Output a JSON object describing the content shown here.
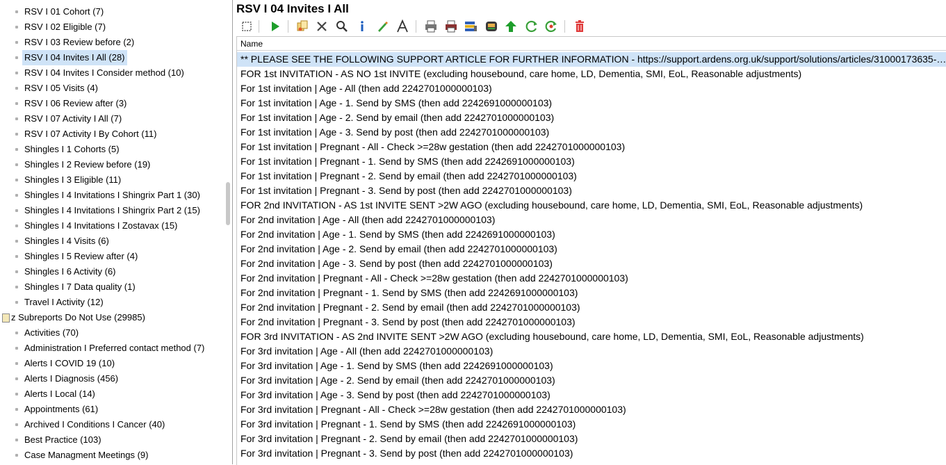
{
  "tree": {
    "items": [
      {
        "label": "RSV I 01 Cohort (7)",
        "type": "child"
      },
      {
        "label": "RSV I 02 Eligible (7)",
        "type": "child"
      },
      {
        "label": "RSV I 03 Review before (2)",
        "type": "child"
      },
      {
        "label": "RSV I 04 Invites I All (28)",
        "type": "child",
        "selected": true
      },
      {
        "label": "RSV I 04 Invites I Consider method (10)",
        "type": "child"
      },
      {
        "label": "RSV I 05 Visits (4)",
        "type": "child"
      },
      {
        "label": "RSV I 06 Review after (3)",
        "type": "child"
      },
      {
        "label": "RSV I 07 Activity I All (7)",
        "type": "child"
      },
      {
        "label": "RSV I 07 Activity I By Cohort (11)",
        "type": "child"
      },
      {
        "label": "Shingles I 1 Cohorts (5)",
        "type": "child"
      },
      {
        "label": "Shingles I 2 Review before (19)",
        "type": "child"
      },
      {
        "label": "Shingles I 3 Eligible (11)",
        "type": "child"
      },
      {
        "label": "Shingles I 4 Invitations I Shingrix Part 1 (30)",
        "type": "child"
      },
      {
        "label": "Shingles I 4 Invitations I Shingrix Part 2 (15)",
        "type": "child"
      },
      {
        "label": "Shingles I 4 Invitations I Zostavax (15)",
        "type": "child"
      },
      {
        "label": "Shingles I 4 Visits (6)",
        "type": "child"
      },
      {
        "label": "Shingles I 5 Review after (4)",
        "type": "child"
      },
      {
        "label": "Shingles I 6 Activity (6)",
        "type": "child"
      },
      {
        "label": "Shingles I 7 Data quality (1)",
        "type": "child"
      },
      {
        "label": "Travel I Activity (12)",
        "type": "child"
      },
      {
        "label": "z Subreports Do Not Use (29985)",
        "type": "root"
      },
      {
        "label": "Activities (70)",
        "type": "child"
      },
      {
        "label": "Administration I Preferred contact method (7)",
        "type": "child"
      },
      {
        "label": "Alerts I COVID 19 (10)",
        "type": "child"
      },
      {
        "label": "Alerts I Diagnosis (456)",
        "type": "child"
      },
      {
        "label": "Alerts I Local (14)",
        "type": "child"
      },
      {
        "label": "Appointments (61)",
        "type": "child"
      },
      {
        "label": "Archived I Conditions I Cancer (40)",
        "type": "child"
      },
      {
        "label": "Best Practice (103)",
        "type": "child"
      },
      {
        "label": "Case Managment Meetings (9)",
        "type": "child"
      }
    ]
  },
  "header": {
    "title": "RSV I 04 Invites I All"
  },
  "toolbar": {
    "buttons": [
      {
        "icon": "select-all-icon"
      },
      {
        "icon": "run-icon"
      },
      {
        "icon": "copy-icon"
      },
      {
        "icon": "delete-x-icon"
      },
      {
        "icon": "search-icon"
      },
      {
        "icon": "info-icon"
      },
      {
        "icon": "edit-pen-icon"
      },
      {
        "icon": "font-icon"
      },
      {
        "icon": "print-icon"
      },
      {
        "icon": "print-color-icon"
      },
      {
        "icon": "export-icon"
      },
      {
        "icon": "schedule-icon"
      },
      {
        "icon": "upload-icon"
      },
      {
        "icon": "refresh-icon"
      },
      {
        "icon": "refresh-alt-icon"
      },
      {
        "icon": "trash-icon"
      }
    ]
  },
  "grid": {
    "column": "Name",
    "rows": [
      "** PLEASE SEE THE FOLLOWING SUPPORT ARTICLE FOR FURTHER INFORMATION - https://support.ardens.org.uk/support/solutions/articles/31000173635-r...",
      "FOR 1st INVITATION - AS NO 1st INVITE (excluding housebound, care home, LD, Dementia, SMI, EoL, Reasonable adjustments)",
      "For 1st invitation | Age -  All (then add 2242701000000103)",
      "For 1st invitation | Age - 1. Send by SMS (then add 2242691000000103)",
      "For 1st invitation | Age - 2. Send by email (then add 2242701000000103)",
      "For 1st invitation | Age - 3. Send by post (then add 2242701000000103)",
      "For 1st invitation | Pregnant -  All - Check >=28w gestation (then add 2242701000000103)",
      "For 1st invitation | Pregnant - 1. Send by SMS (then add 2242691000000103)",
      "For 1st invitation | Pregnant - 2. Send by email (then add 2242701000000103)",
      "For 1st invitation | Pregnant - 3. Send by post (then add 2242701000000103)",
      "FOR 2nd INVITATION - AS 1st INVITE SENT >2W AGO (excluding housebound, care home, LD, Dementia, SMI, EoL, Reasonable adjustments)",
      "For 2nd invitation | Age -  All (then add 2242701000000103)",
      "For 2nd invitation | Age - 1. Send by SMS (then add 2242691000000103)",
      "For 2nd invitation | Age - 2. Send by email (then add 2242701000000103)",
      "For 2nd invitation | Age - 3. Send by post (then add 2242701000000103)",
      "For 2nd invitation | Pregnant -  All - Check >=28w gestation (then add 2242701000000103)",
      "For 2nd invitation | Pregnant - 1. Send by SMS (then add 2242691000000103)",
      "For 2nd invitation | Pregnant - 2. Send by email (then add 2242701000000103)",
      "For 2nd invitation | Pregnant - 3. Send by post (then add 2242701000000103)",
      "FOR 3rd INVITATION - AS 2nd INVITE SENT >2W AGO (excluding housebound, care home, LD, Dementia, SMI, EoL, Reasonable adjustments)",
      "For 3rd invitation | Age -  All (then add 2242701000000103)",
      "For 3rd invitation | Age - 1. Send by SMS (then add 2242691000000103)",
      "For 3rd invitation | Age - 2. Send by email (then add 2242701000000103)",
      "For 3rd invitation | Age - 3. Send by post (then add 2242701000000103)",
      "For 3rd invitation | Pregnant -  All - Check >=28w gestation (then add 2242701000000103)",
      "For 3rd invitation | Pregnant - 1. Send by SMS (then add 2242691000000103)",
      "For 3rd invitation | Pregnant - 2. Send by email (then add 2242701000000103)",
      "For 3rd invitation | Pregnant - 3. Send by post (then add 2242701000000103)"
    ],
    "selected_row": 0
  },
  "colors": {
    "selection": "#cfe3f7",
    "run_green": "#1e9e2b",
    "delete_red": "#e03a3a"
  }
}
